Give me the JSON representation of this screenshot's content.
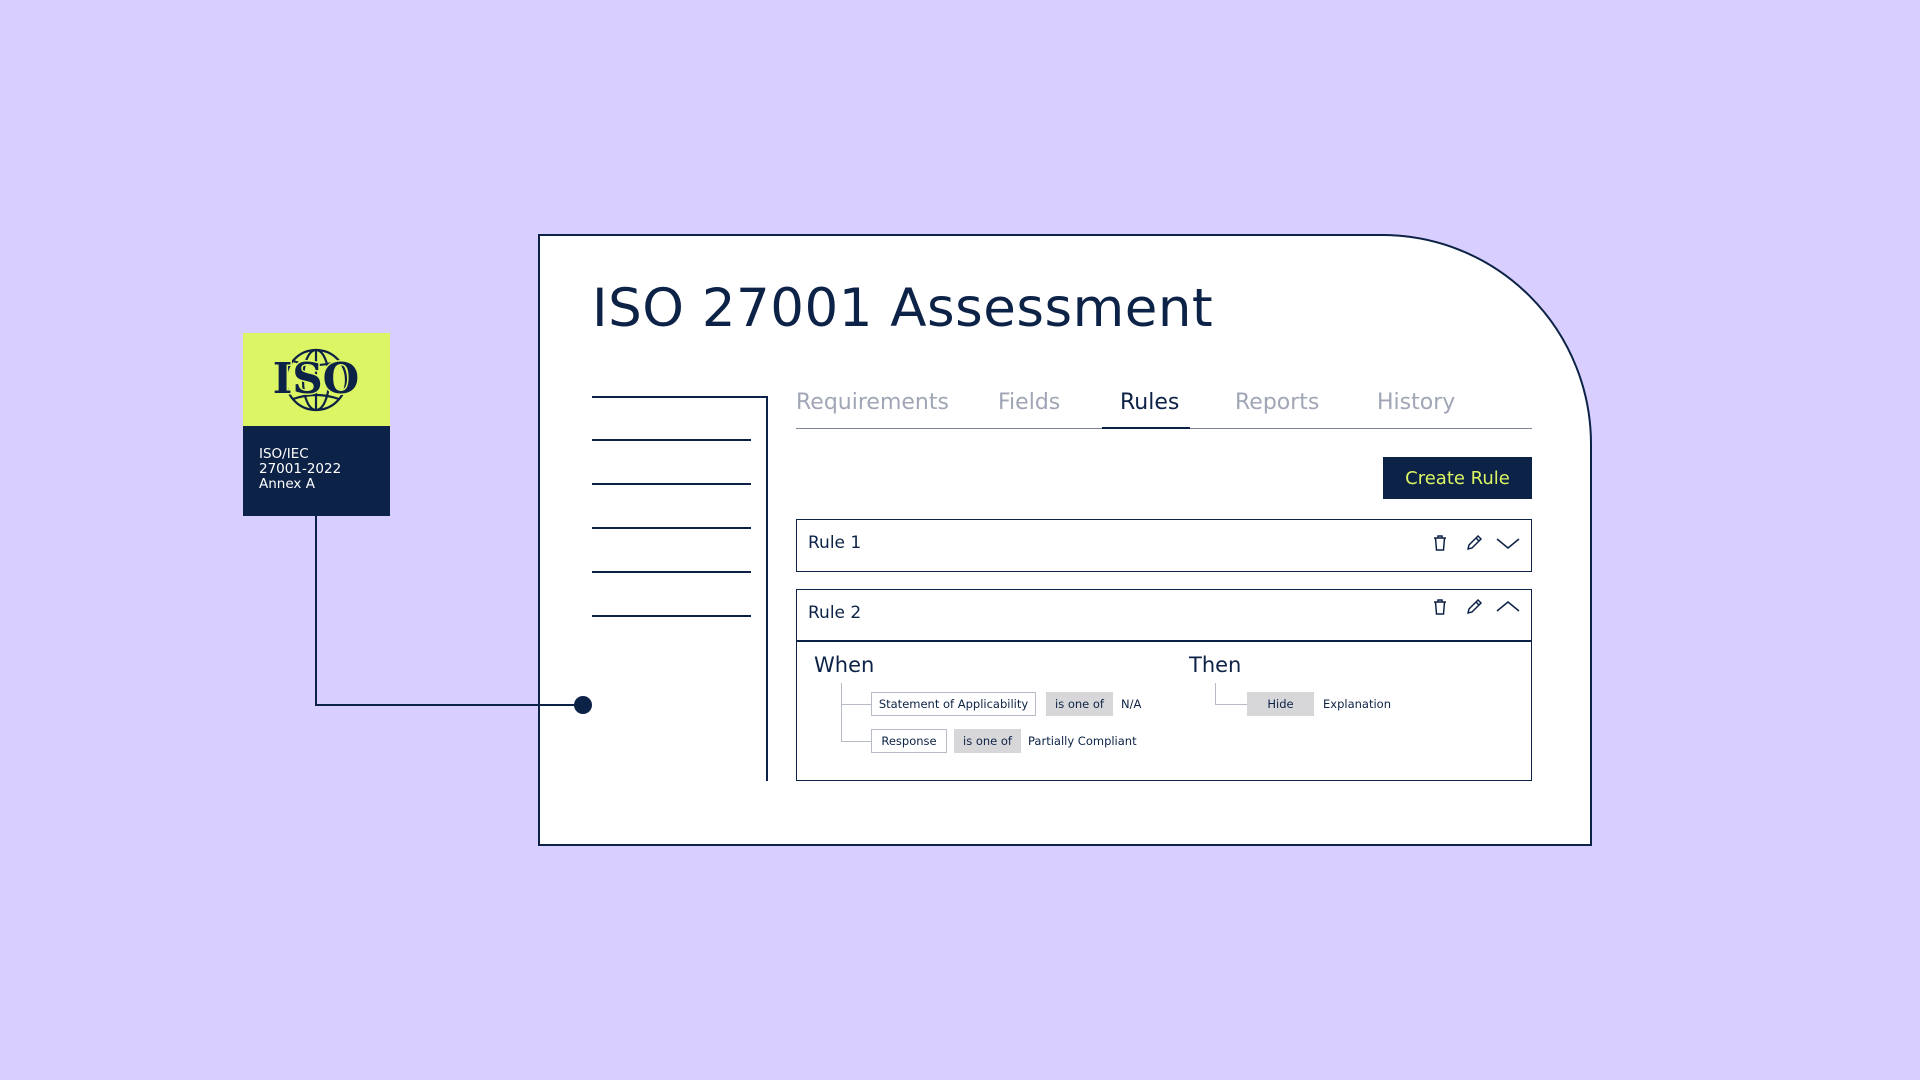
{
  "badge": {
    "logo_text": "ISO",
    "lines": [
      "ISO/IEC",
      "27001-2022",
      "Annex A"
    ]
  },
  "page_title": "ISO 27001 Assessment",
  "tabs": [
    {
      "label": "Requirements",
      "active": false
    },
    {
      "label": "Fields",
      "active": false
    },
    {
      "label": "Rules",
      "active": true
    },
    {
      "label": "Reports",
      "active": false
    },
    {
      "label": "History",
      "active": false
    }
  ],
  "create_button": "Create Rule",
  "rules": [
    {
      "name": "Rule 1",
      "expanded": false
    },
    {
      "name": "Rule 2",
      "expanded": true,
      "when_label": "When",
      "then_label": "Then",
      "conditions": [
        {
          "field": "Statement of Applicability",
          "operator": "is one of",
          "value": "N/A"
        },
        {
          "field": "Response",
          "operator": "is one of",
          "value": "Partially Compliant"
        }
      ],
      "actions": [
        {
          "action": "Hide",
          "target": "Explanation"
        }
      ]
    }
  ],
  "icons": {
    "delete": "trash-icon",
    "edit": "pencil-icon",
    "collapse": "chevron-up-icon",
    "expand": "chevron-down-icon",
    "logo": "globe-icon"
  },
  "colors": {
    "background": "#d9cfff",
    "navy": "#0c2246",
    "lime": "#dcf564",
    "chip_grey": "#d7d7d9",
    "inactive_tab": "#a0a6b5"
  }
}
